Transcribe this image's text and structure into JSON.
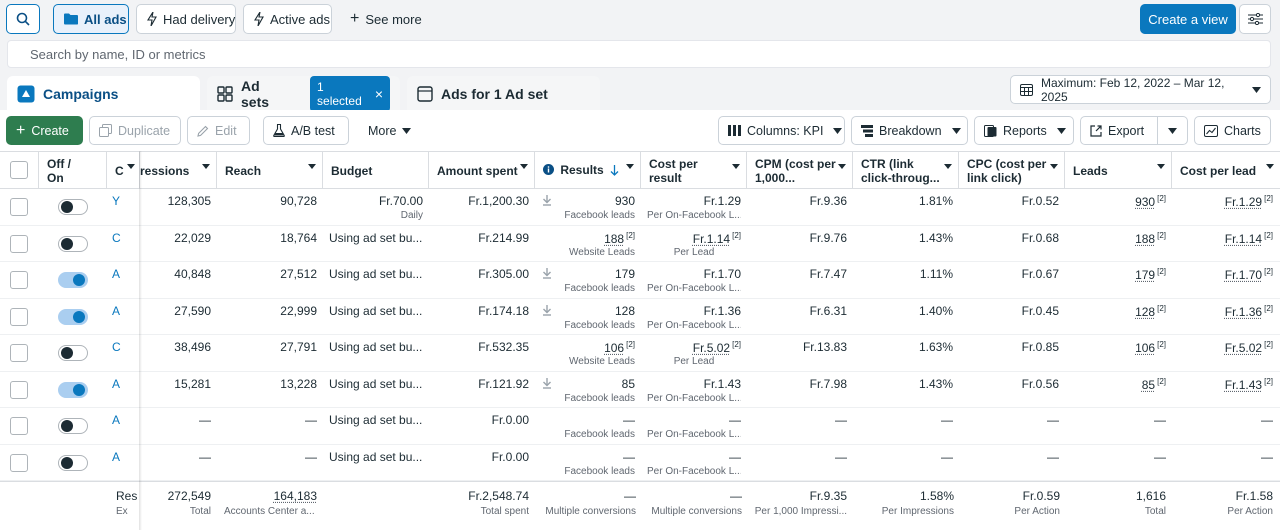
{
  "topbar": {
    "all_ads": "All ads",
    "had_delivery": "Had delivery",
    "active_ads": "Active ads",
    "see_more": "See more",
    "create_view": "Create a view"
  },
  "search": {
    "placeholder": "Search by name, ID or metrics"
  },
  "levels": {
    "campaigns": "Campaigns",
    "ad_sets": "Ad sets",
    "selected": "1 selected",
    "ads": "Ads for 1 Ad set"
  },
  "date_range": "Maximum: Feb 12, 2022 – Mar 12, 2025",
  "toolbar": {
    "create": "Create",
    "duplicate": "Duplicate",
    "edit": "Edit",
    "ab_test": "A/B test",
    "more": "More",
    "columns": "Columns: KPI",
    "breakdown": "Breakdown",
    "reports": "Reports",
    "export": "Export",
    "charts": "Charts"
  },
  "columns": {
    "off_on": [
      "Off /",
      "On"
    ],
    "name_stub": "C",
    "impressions": "ressions",
    "reach": "Reach",
    "budget": "Budget",
    "amount_spent": "Amount spent",
    "results": "Results",
    "cost_per_result": [
      "Cost per",
      "result"
    ],
    "cpm": [
      "CPM (cost per",
      "1,000..."
    ],
    "ctr": [
      "CTR (link",
      "click-throug..."
    ],
    "cpc": [
      "CPC (cost per",
      "link click)"
    ],
    "leads": "Leads",
    "cost_per_lead": "Cost per lead"
  },
  "rows": [
    {
      "name": "Y",
      "on": false,
      "impressions": "128,305",
      "reach": "90,728",
      "budget": "Fr.70.00",
      "budget_sub": "Daily",
      "spent": "Fr.1,200.30",
      "results": "930",
      "results_sup": "",
      "results_sub": "Facebook leads",
      "cpr": "Fr.1.29",
      "cpr_sup": "",
      "cpr_sub": "Per On-Facebook L...",
      "cpm": "Fr.9.36",
      "ctr": "1.81%",
      "cpc": "Fr.0.52",
      "leads": "930",
      "cpl": "Fr.1.29",
      "dl": true
    },
    {
      "name": "C",
      "on": false,
      "impressions": "22,029",
      "reach": "18,764",
      "budget": "Using ad set bu...",
      "budget_sub": "",
      "spent": "Fr.214.99",
      "results": "188",
      "results_sup": "[2]",
      "results_sub": "Website Leads",
      "cpr": "Fr.1.14",
      "cpr_sup": "[2]",
      "cpr_sub": "Per Lead",
      "cpm": "Fr.9.76",
      "ctr": "1.43%",
      "cpc": "Fr.0.68",
      "leads": "188",
      "cpl": "Fr.1.14",
      "dl": false
    },
    {
      "name": "A",
      "on": true,
      "impressions": "40,848",
      "reach": "27,512",
      "budget": "Using ad set bu...",
      "budget_sub": "",
      "spent": "Fr.305.00",
      "results": "179",
      "results_sup": "",
      "results_sub": "Facebook leads",
      "cpr": "Fr.1.70",
      "cpr_sup": "",
      "cpr_sub": "Per On-Facebook L...",
      "cpm": "Fr.7.47",
      "ctr": "1.11%",
      "cpc": "Fr.0.67",
      "leads": "179",
      "cpl": "Fr.1.70",
      "dl": true
    },
    {
      "name": "A",
      "on": true,
      "impressions": "27,590",
      "reach": "22,999",
      "budget": "Using ad set bu...",
      "budget_sub": "",
      "spent": "Fr.174.18",
      "results": "128",
      "results_sup": "",
      "results_sub": "Facebook leads",
      "cpr": "Fr.1.36",
      "cpr_sup": "",
      "cpr_sub": "Per On-Facebook L...",
      "cpm": "Fr.6.31",
      "ctr": "1.40%",
      "cpc": "Fr.0.45",
      "leads": "128",
      "cpl": "Fr.1.36",
      "dl": true
    },
    {
      "name": "C",
      "on": false,
      "impressions": "38,496",
      "reach": "27,791",
      "budget": "Using ad set bu...",
      "budget_sub": "",
      "spent": "Fr.532.35",
      "results": "106",
      "results_sup": "[2]",
      "results_sub": "Website Leads",
      "cpr": "Fr.5.02",
      "cpr_sup": "[2]",
      "cpr_sub": "Per Lead",
      "cpm": "Fr.13.83",
      "ctr": "1.63%",
      "cpc": "Fr.0.85",
      "leads": "106",
      "cpl": "Fr.5.02",
      "dl": false
    },
    {
      "name": "A",
      "on": true,
      "impressions": "15,281",
      "reach": "13,228",
      "budget": "Using ad set bu...",
      "budget_sub": "",
      "spent": "Fr.121.92",
      "results": "85",
      "results_sup": "",
      "results_sub": "Facebook leads",
      "cpr": "Fr.1.43",
      "cpr_sup": "",
      "cpr_sub": "Per On-Facebook L...",
      "cpm": "Fr.7.98",
      "ctr": "1.43%",
      "cpc": "Fr.0.56",
      "leads": "85",
      "cpl": "Fr.1.43",
      "dl": true
    },
    {
      "name": "A",
      "on": false,
      "impressions": "—",
      "reach": "—",
      "budget": "Using ad set bu...",
      "budget_sub": "",
      "spent": "Fr.0.00",
      "results": "—",
      "results_sup": "",
      "results_sub": "Facebook leads",
      "cpr": "—",
      "cpr_sup": "",
      "cpr_sub": "Per On-Facebook L...",
      "cpm": "—",
      "ctr": "—",
      "cpc": "—",
      "leads": "—",
      "cpl": "—",
      "dl": false
    },
    {
      "name": "A",
      "on": false,
      "impressions": "—",
      "reach": "—",
      "budget": "Using ad set bu...",
      "budget_sub": "",
      "spent": "Fr.0.00",
      "results": "—",
      "results_sup": "",
      "results_sub": "Facebook leads",
      "cpr": "—",
      "cpr_sup": "",
      "cpr_sub": "Per On-Facebook L...",
      "cpm": "—",
      "ctr": "—",
      "cpc": "—",
      "leads": "—",
      "cpl": "—",
      "dl": false
    }
  ],
  "totals": {
    "name": "Res",
    "name_sub": "Ex",
    "impressions": "272,549",
    "impressions_sub": "Total",
    "reach": "164,183",
    "reach_sub": "Accounts Center a...",
    "spent": "Fr.2,548.74",
    "spent_sub": "Total spent",
    "results": "—",
    "results_sub": "Multiple conversions",
    "cpr": "—",
    "cpr_sub": "Multiple conversions",
    "cpm": "Fr.9.35",
    "cpm_sub": "Per 1,000 Impressi...",
    "ctr": "1.58%",
    "ctr_sub": "Per Impressions",
    "cpc": "Fr.0.59",
    "cpc_sub": "Per Action",
    "leads": "1,616",
    "leads_sub": "Total",
    "cpl": "Fr.1.58",
    "cpl_sub": "Per Action"
  },
  "colors": {
    "accent": "#0a78be",
    "create_green": "#2e7d4f"
  }
}
